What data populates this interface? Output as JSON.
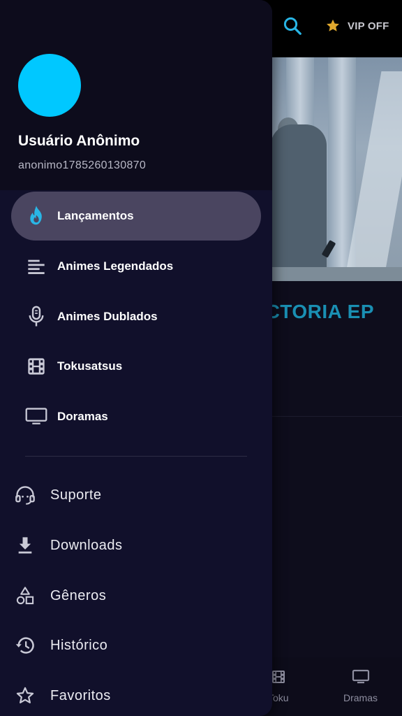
{
  "background": {
    "vip_label": "VIP OFF",
    "banner_title": "CTORIA EP",
    "bottom_nav": [
      {
        "label": "Toku",
        "icon": "film-icon"
      },
      {
        "label": "Dramas",
        "icon": "tv-icon"
      }
    ]
  },
  "drawer": {
    "user": {
      "name": "Usuário Anônimo",
      "id": "anonimo1785260130870",
      "avatar_color": "#00c8ff"
    },
    "primary_items": [
      {
        "label": "Lançamentos",
        "icon": "fire-icon",
        "active": true
      },
      {
        "label": "Animes Legendados",
        "icon": "list-icon"
      },
      {
        "label": "Animes Dublados",
        "icon": "microphone-icon"
      },
      {
        "label": "Tokusatsus",
        "icon": "film-icon"
      },
      {
        "label": "Doramas",
        "icon": "tv-icon"
      }
    ],
    "secondary_items": [
      {
        "label": "Suporte",
        "icon": "headset-icon"
      },
      {
        "label": "Downloads",
        "icon": "download-icon"
      },
      {
        "label": "Gêneros",
        "icon": "shapes-icon"
      },
      {
        "label": "Histórico",
        "icon": "history-icon"
      },
      {
        "label": "Favoritos",
        "icon": "star-icon"
      }
    ]
  },
  "colors": {
    "accent": "#29b6e6",
    "active_bg": "#4a4560",
    "drawer_bg": "#11102b",
    "star": "#e0a82e"
  }
}
